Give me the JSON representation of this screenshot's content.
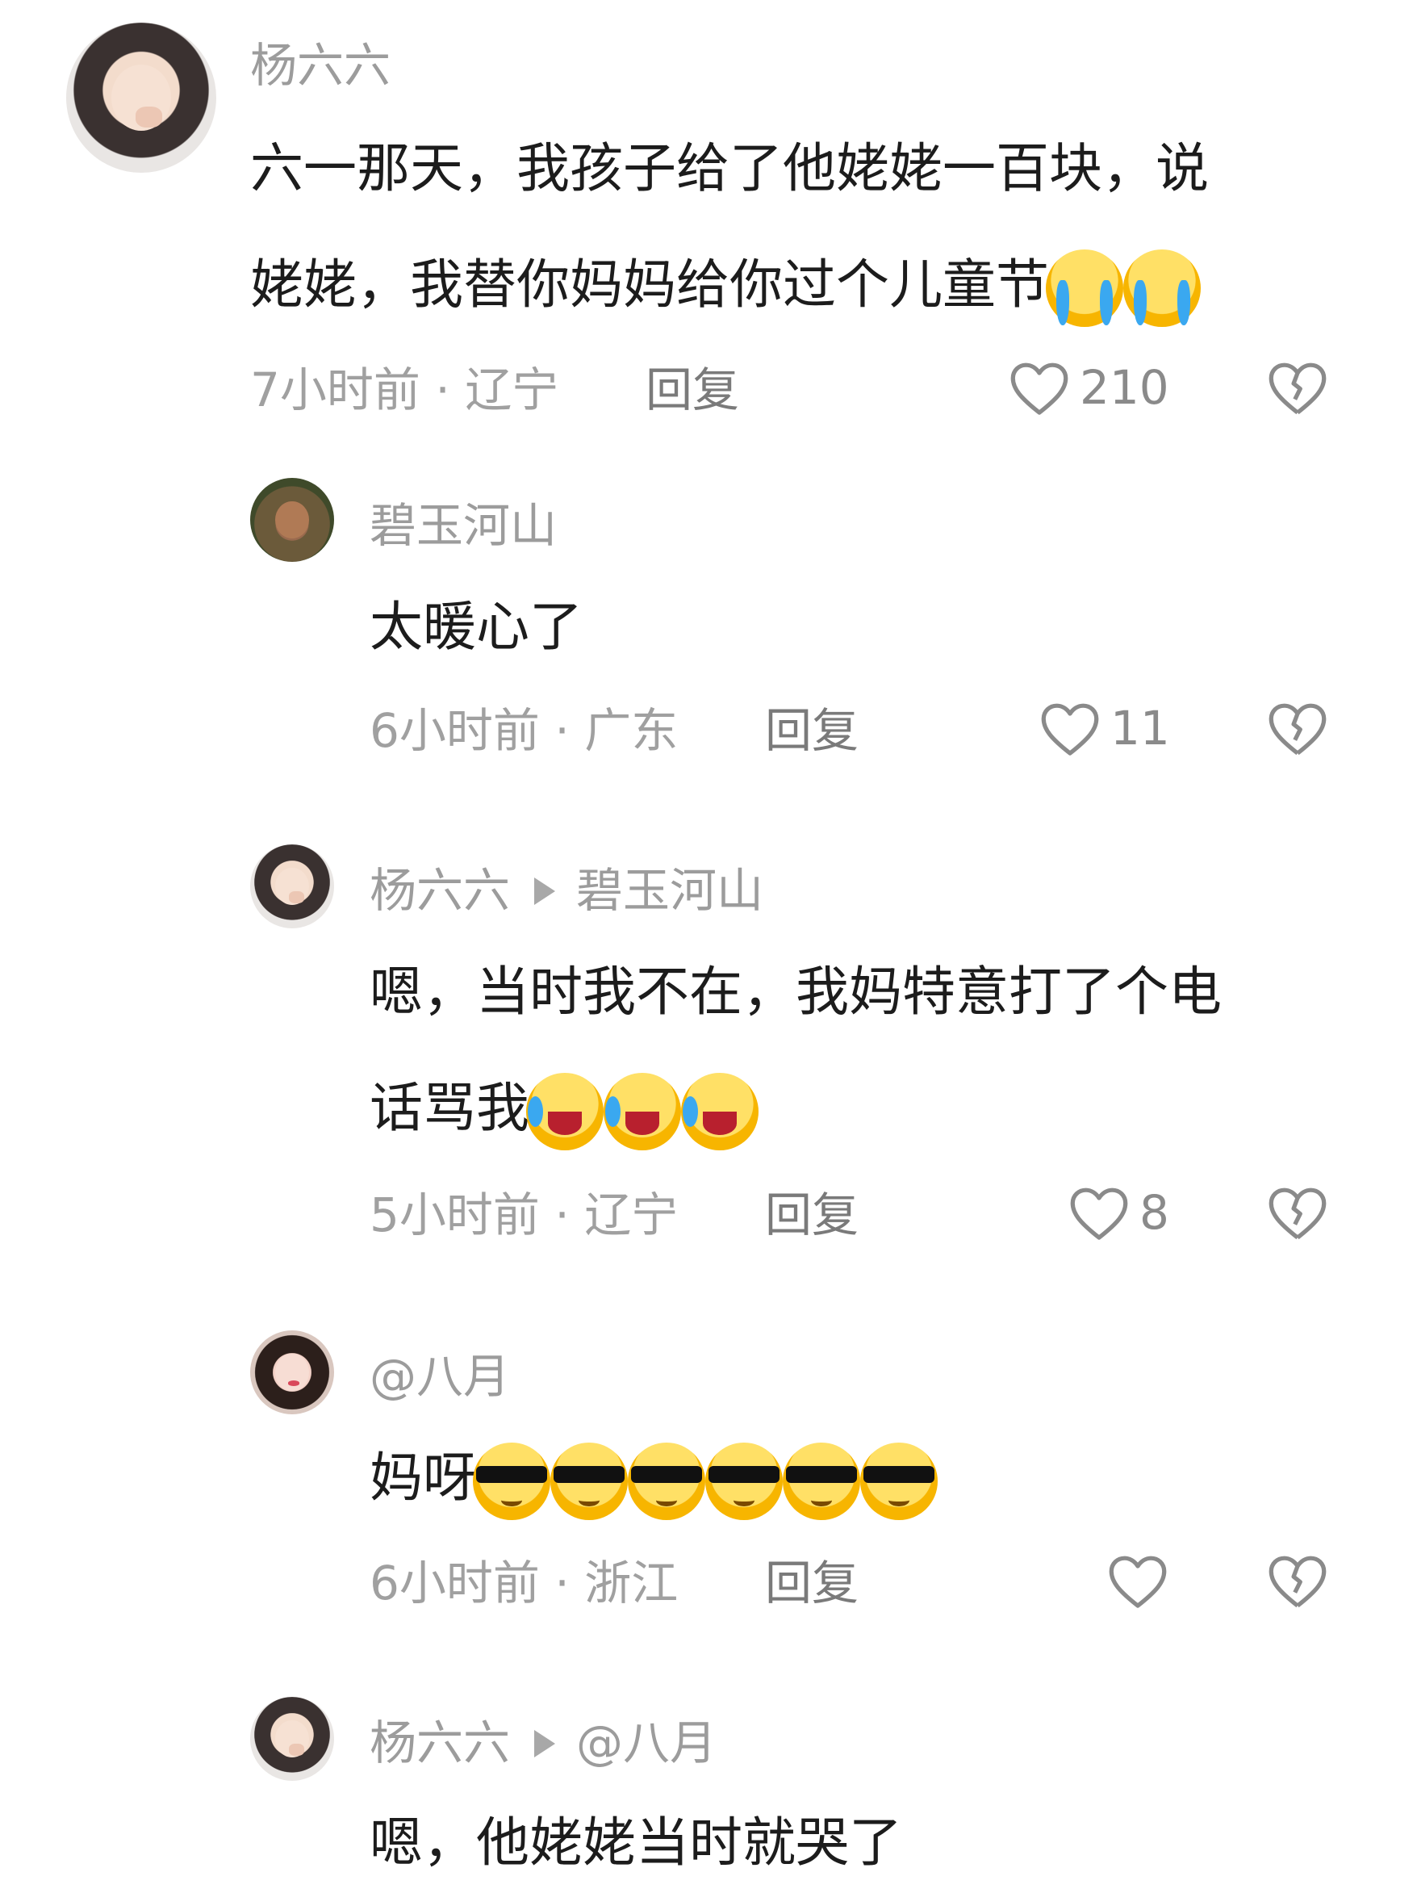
{
  "comments": [
    {
      "user": "杨六六",
      "text_lines": [
        "六一那天，我孩子给了他姥姥一百块，说",
        "姥姥，我替你妈妈给你过个儿童节"
      ],
      "emojis": [
        "loudly-crying-face",
        "loudly-crying-face"
      ],
      "time_location": "7小时前 · 辽宁",
      "reply_label": "回复",
      "likes": "210"
    },
    {
      "user": "碧玉河山",
      "text_lines": [
        "太暖心了"
      ],
      "time_location": "6小时前 · 广东",
      "reply_label": "回复",
      "likes": "11"
    },
    {
      "user": "杨六六",
      "reply_to": "碧玉河山",
      "text_lines": [
        "嗯，当时我不在，我妈特意打了个电",
        "话骂我"
      ],
      "emojis": [
        "rolling-laughing-face",
        "rolling-laughing-face",
        "rolling-laughing-face"
      ],
      "time_location": "5小时前 · 辽宁",
      "reply_label": "回复",
      "likes": "8"
    },
    {
      "user": "@八月",
      "text_lines": [
        "妈呀"
      ],
      "emojis": [
        "cool-crying-face",
        "cool-crying-face",
        "cool-crying-face",
        "cool-crying-face",
        "cool-crying-face",
        "cool-crying-face"
      ],
      "time_location": "6小时前 · 浙江",
      "reply_label": "回复",
      "likes": ""
    },
    {
      "user": "杨六六",
      "reply_to": "@八月",
      "text_lines": [
        "嗯，他姥姥当时就哭了"
      ]
    }
  ]
}
